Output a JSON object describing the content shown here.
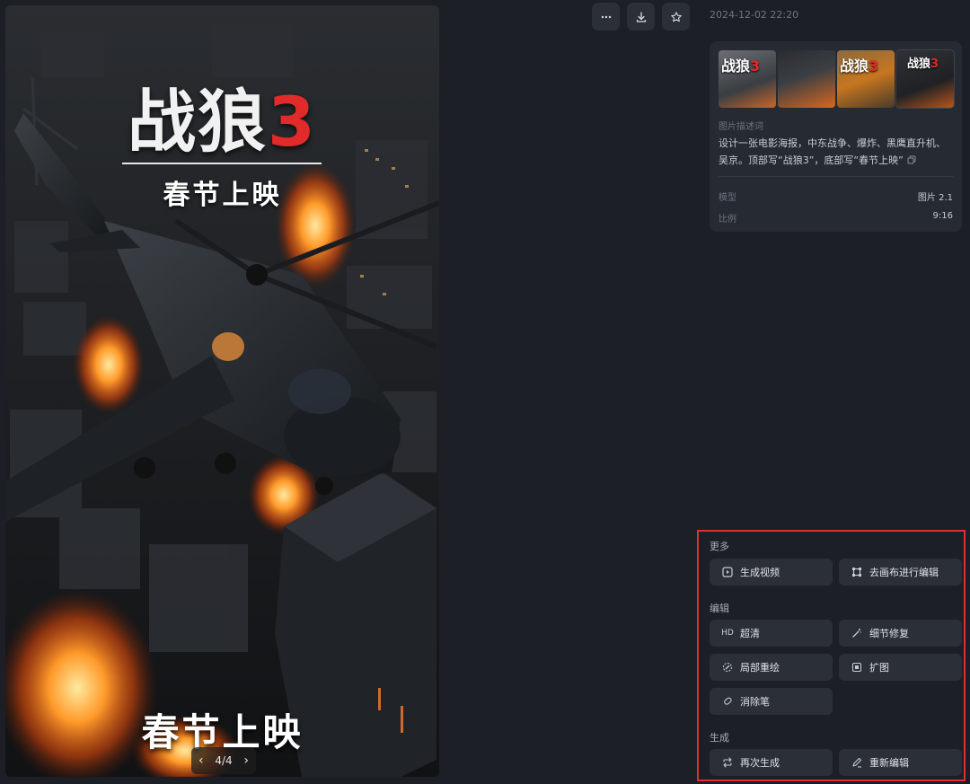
{
  "toolbar": {
    "more_icon": "more-horizontal-icon",
    "download_icon": "download-icon",
    "favorite_icon": "star-icon"
  },
  "image": {
    "title_main": "战狼",
    "title_number": "3",
    "subtitle_top": "春节上映",
    "subtitle_bottom": "春节上映",
    "pager": "4/4"
  },
  "info": {
    "timestamp": "2024-12-02 22:20",
    "thumbnails": [
      {
        "label_main": "战狼",
        "label_num": "3"
      },
      {
        "label_main": "",
        "label_num": ""
      },
      {
        "label_main": "战狼",
        "label_num": "3"
      },
      {
        "label_main": "战狼",
        "label_num": "3"
      }
    ],
    "description_label": "图片描述词",
    "description": "设计一张电影海报，中东战争、爆炸、黑鹰直升机、吴京。顶部写“战狼3”，底部写“春节上映”",
    "model_label": "模型",
    "model_value": "图片 2.1",
    "ratio_label": "比例",
    "ratio_value": "9:16"
  },
  "actions": {
    "more_label": "更多",
    "generate_video": "生成视频",
    "canvas_edit": "去画布进行编辑",
    "edit_label": "编辑",
    "hd_prefix": "HD",
    "upscale": "超清",
    "detail_fix": "细节修复",
    "inpaint": "局部重绘",
    "outpaint": "扩图",
    "eraser": "消除笔",
    "generate_label": "生成",
    "regenerate": "再次生成",
    "reedit": "重新编辑"
  },
  "colors": {
    "background": "#1c1f26",
    "card": "#262a32",
    "button": "#2b2f38",
    "highlight_border": "#e0302e",
    "poster_red": "#e12a2a"
  }
}
